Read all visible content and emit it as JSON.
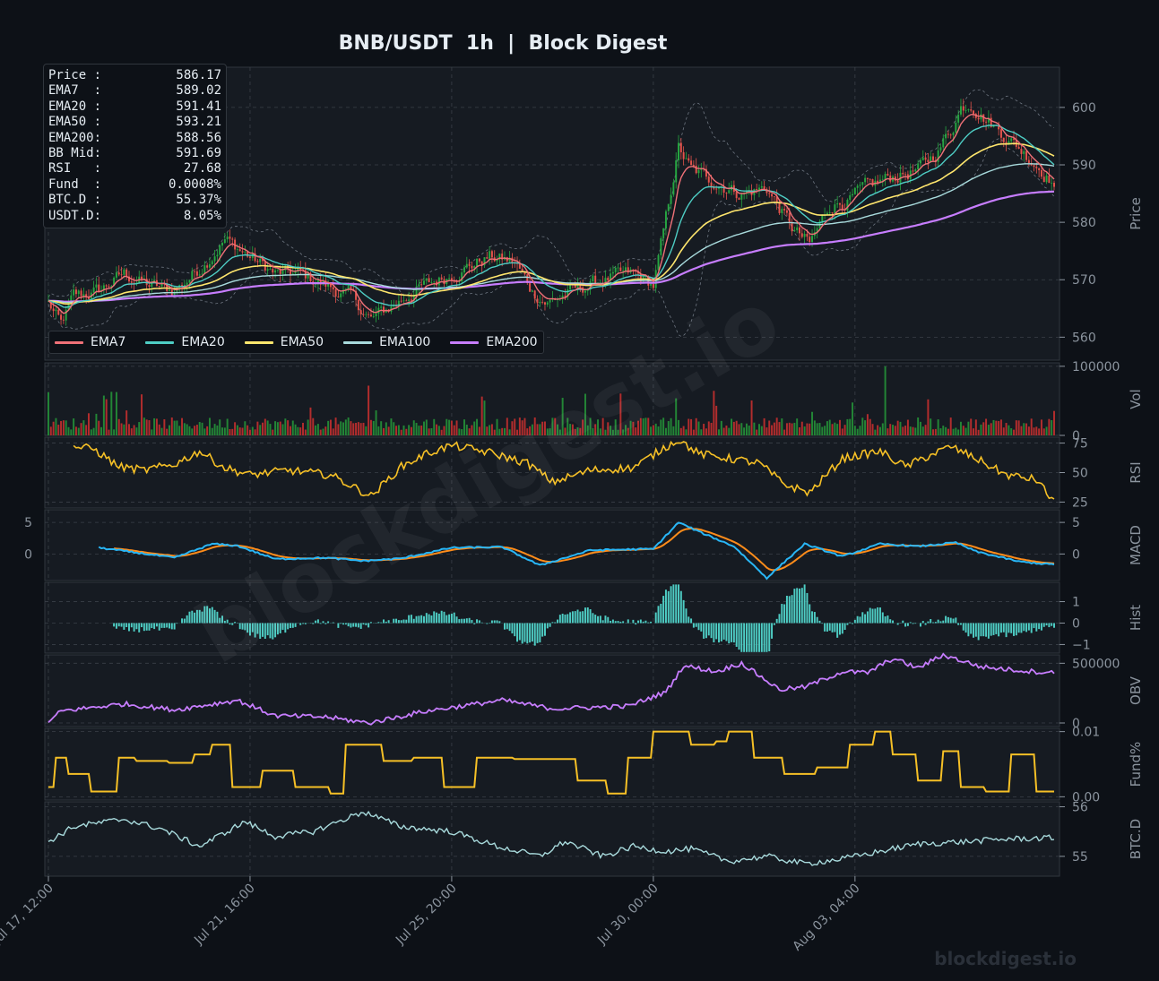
{
  "title": "BNB/USDT  1h  |  Block Digest",
  "info_box": [
    {
      "label": "Price :",
      "value": "586.17"
    },
    {
      "label": "EMA7  :",
      "value": "589.02"
    },
    {
      "label": "EMA20 :",
      "value": "591.41"
    },
    {
      "label": "EMA50 :",
      "value": "593.21"
    },
    {
      "label": "EMA200:",
      "value": "588.56"
    },
    {
      "label": "BB Mid:",
      "value": "591.69"
    },
    {
      "label": "RSI   :",
      "value": "27.68"
    },
    {
      "label": "Fund  :",
      "value": "0.0008%"
    },
    {
      "label": "BTC.D :",
      "value": "55.37%"
    },
    {
      "label": "USDT.D:",
      "value": "8.05%"
    }
  ],
  "watermark": "blockdigest.io",
  "diagonal_watermark": "blockdigest.io",
  "colors": {
    "background": "#0d1117",
    "panel": "#161b22",
    "grid": "#3a4048",
    "up": "#26a641",
    "down": "#e5534b",
    "ema7": "#f07178",
    "ema20": "#4ecdc4",
    "ema50": "#ffe66d",
    "ema100": "#a8dadc",
    "ema200": "#c77dff",
    "rsi": "#f6c026",
    "macd": "#29b6f6",
    "signal": "#ff8c1a",
    "hist": "#4ecdc4",
    "obv": "#c77dff",
    "funding": "#f6c026",
    "btcd": "#a8dadc"
  },
  "chart_data": {
    "type": "line",
    "x_ticks": [
      "Jul 17, 12:00",
      "Jul 21, 16:00",
      "Jul 25, 20:00",
      "Jul 30, 00:00",
      "Aug 03, 04:00"
    ],
    "legend": [
      "EMA7",
      "EMA20",
      "EMA50",
      "EMA100",
      "EMA200"
    ],
    "legend_placement": "lower-left",
    "grid": true,
    "panels": [
      {
        "name": "price",
        "ylabel": "Price",
        "ylim": [
          556,
          607
        ],
        "ticks": [
          "560",
          "570",
          "580",
          "590",
          "600"
        ]
      },
      {
        "name": "volume",
        "ylabel": "Vol",
        "ylim": [
          0,
          105000
        ],
        "ticks": [
          "0",
          "100000"
        ]
      },
      {
        "name": "rsi",
        "ylabel": "RSI",
        "ylim": [
          20,
          80
        ],
        "ticks": [
          "25",
          "50",
          "75"
        ]
      },
      {
        "name": "macd",
        "ylabel": "MACD",
        "ylim": [
          -4.2,
          7
        ],
        "ticks": [
          "0",
          "5"
        ],
        "left_ticks": [
          "0",
          "5"
        ]
      },
      {
        "name": "hist",
        "ylabel": "Hist",
        "ylim": [
          -1.4,
          1.9
        ],
        "ticks": [
          "−1",
          "0",
          "1"
        ]
      },
      {
        "name": "obv",
        "ylabel": "OBV",
        "ylim": [
          -30000,
          570000
        ],
        "ticks": [
          "0",
          "500000"
        ]
      },
      {
        "name": "funding",
        "ylabel": "Fund%",
        "ylim": [
          -0.0005,
          0.0105
        ],
        "ticks": [
          "0.00",
          "0.01"
        ]
      },
      {
        "name": "btcd",
        "ylabel": "BTC.D",
        "ylim": [
          54.6,
          56.1
        ],
        "ticks": [
          "55",
          "56"
        ]
      }
    ],
    "price_anchors": [
      [
        0,
        566
      ],
      [
        5,
        562
      ],
      [
        10,
        567
      ],
      [
        20,
        568
      ],
      [
        30,
        571
      ],
      [
        40,
        569
      ],
      [
        50,
        568
      ],
      [
        60,
        572
      ],
      [
        70,
        577
      ],
      [
        80,
        574
      ],
      [
        90,
        571
      ],
      [
        100,
        571
      ],
      [
        110,
        569
      ],
      [
        120,
        567
      ],
      [
        128,
        563
      ],
      [
        135,
        565
      ],
      [
        145,
        568
      ],
      [
        160,
        571
      ],
      [
        175,
        574
      ],
      [
        185,
        573
      ],
      [
        192,
        568
      ],
      [
        198,
        566
      ],
      [
        208,
        568
      ],
      [
        220,
        570
      ],
      [
        232,
        571
      ],
      [
        240,
        569
      ],
      [
        244,
        578
      ],
      [
        250,
        593
      ],
      [
        255,
        589
      ],
      [
        265,
        587
      ],
      [
        275,
        585
      ],
      [
        285,
        586
      ],
      [
        295,
        579
      ],
      [
        302,
        576
      ],
      [
        310,
        583
      ],
      [
        318,
        584
      ],
      [
        325,
        586
      ],
      [
        335,
        588
      ],
      [
        345,
        589
      ],
      [
        352,
        592
      ],
      [
        358,
        596
      ],
      [
        362,
        600
      ],
      [
        366,
        601
      ],
      [
        372,
        598
      ],
      [
        380,
        595
      ],
      [
        390,
        591
      ],
      [
        399,
        587
      ]
    ],
    "ema_last": {
      "EMA7": 589.02,
      "EMA20": 591.41,
      "EMA50": 593.21,
      "EMA200": 588.56
    },
    "ema100_last": 592.0,
    "rsi_anchors": [
      [
        10,
        72
      ],
      [
        18,
        70
      ],
      [
        28,
        55
      ],
      [
        38,
        52
      ],
      [
        50,
        57
      ],
      [
        60,
        68
      ],
      [
        70,
        54
      ],
      [
        80,
        48
      ],
      [
        95,
        52
      ],
      [
        112,
        48
      ],
      [
        128,
        30
      ],
      [
        140,
        55
      ],
      [
        150,
        66
      ],
      [
        160,
        73
      ],
      [
        175,
        67
      ],
      [
        190,
        58
      ],
      [
        200,
        42
      ],
      [
        215,
        52
      ],
      [
        232,
        54
      ],
      [
        245,
        72
      ],
      [
        250,
        78
      ],
      [
        258,
        66
      ],
      [
        270,
        62
      ],
      [
        282,
        58
      ],
      [
        292,
        40
      ],
      [
        302,
        33
      ],
      [
        315,
        62
      ],
      [
        330,
        68
      ],
      [
        340,
        55
      ],
      [
        350,
        65
      ],
      [
        358,
        72
      ],
      [
        368,
        62
      ],
      [
        380,
        48
      ],
      [
        392,
        44
      ],
      [
        397,
        30
      ],
      [
        399,
        27.68
      ]
    ],
    "macd_anchors": [
      [
        20,
        1.0
      ],
      [
        35,
        0.2
      ],
      [
        50,
        -0.6
      ],
      [
        65,
        1.6
      ],
      [
        75,
        1.3
      ],
      [
        90,
        -0.8
      ],
      [
        110,
        -0.6
      ],
      [
        125,
        -1.1
      ],
      [
        140,
        -0.7
      ],
      [
        160,
        1.0
      ],
      [
        180,
        1.1
      ],
      [
        195,
        -1.8
      ],
      [
        215,
        0.6
      ],
      [
        240,
        0.8
      ],
      [
        250,
        5.0
      ],
      [
        260,
        3.2
      ],
      [
        272,
        1.2
      ],
      [
        285,
        -3.8
      ],
      [
        300,
        1.6
      ],
      [
        315,
        -0.4
      ],
      [
        330,
        1.6
      ],
      [
        345,
        1.2
      ],
      [
        360,
        1.8
      ],
      [
        368,
        0.4
      ],
      [
        385,
        -1.2
      ],
      [
        396,
        -1.6
      ]
    ],
    "obv_anchors": [
      [
        0,
        0
      ],
      [
        5,
        100000
      ],
      [
        30,
        160000
      ],
      [
        50,
        110000
      ],
      [
        75,
        190000
      ],
      [
        90,
        60000
      ],
      [
        110,
        50000
      ],
      [
        127,
        0
      ],
      [
        150,
        100000
      ],
      [
        180,
        190000
      ],
      [
        200,
        120000
      ],
      [
        230,
        140000
      ],
      [
        245,
        260000
      ],
      [
        252,
        480000
      ],
      [
        265,
        430000
      ],
      [
        275,
        500000
      ],
      [
        290,
        280000
      ],
      [
        300,
        300000
      ],
      [
        315,
        430000
      ],
      [
        325,
        420000
      ],
      [
        335,
        540000
      ],
      [
        345,
        460000
      ],
      [
        355,
        570000
      ],
      [
        370,
        470000
      ],
      [
        385,
        440000
      ],
      [
        399,
        420000
      ]
    ],
    "funding_steps": [
      [
        0,
        0.0015
      ],
      [
        3,
        0.006
      ],
      [
        8,
        0.0035
      ],
      [
        17,
        0.0008
      ],
      [
        28,
        0.006
      ],
      [
        35,
        0.0055
      ],
      [
        48,
        0.0052
      ],
      [
        58,
        0.0065
      ],
      [
        65,
        0.008
      ],
      [
        73,
        0.0015
      ],
      [
        85,
        0.004
      ],
      [
        98,
        0.0015
      ],
      [
        112,
        0.0005
      ],
      [
        118,
        0.008
      ],
      [
        133,
        0.0055
      ],
      [
        145,
        0.006
      ],
      [
        157,
        0.0015
      ],
      [
        170,
        0.006
      ],
      [
        185,
        0.0058
      ],
      [
        210,
        0.0025
      ],
      [
        222,
        0.0005
      ],
      [
        230,
        0.006
      ],
      [
        240,
        0.01
      ],
      [
        255,
        0.008
      ],
      [
        265,
        0.0085
      ],
      [
        270,
        0.01
      ],
      [
        280,
        0.006
      ],
      [
        292,
        0.0035
      ],
      [
        305,
        0.0045
      ],
      [
        318,
        0.008
      ],
      [
        328,
        0.01
      ],
      [
        335,
        0.0065
      ],
      [
        345,
        0.0025
      ],
      [
        355,
        0.007
      ],
      [
        362,
        0.0015
      ],
      [
        372,
        0.0008
      ],
      [
        382,
        0.0065
      ],
      [
        392,
        0.0008
      ],
      [
        399,
        0.0008
      ]
    ],
    "btcd_anchors": [
      [
        0,
        55.3
      ],
      [
        10,
        55.6
      ],
      [
        30,
        55.75
      ],
      [
        45,
        55.55
      ],
      [
        60,
        55.2
      ],
      [
        78,
        55.7
      ],
      [
        90,
        55.4
      ],
      [
        105,
        55.5
      ],
      [
        125,
        55.9
      ],
      [
        140,
        55.6
      ],
      [
        160,
        55.5
      ],
      [
        178,
        55.2
      ],
      [
        195,
        55.0
      ],
      [
        205,
        55.3
      ],
      [
        220,
        55.0
      ],
      [
        232,
        55.2
      ],
      [
        245,
        55.1
      ],
      [
        255,
        55.15
      ],
      [
        270,
        54.9
      ],
      [
        285,
        55.0
      ],
      [
        300,
        54.85
      ],
      [
        315,
        54.95
      ],
      [
        325,
        55.05
      ],
      [
        345,
        55.25
      ],
      [
        365,
        55.3
      ],
      [
        380,
        55.35
      ],
      [
        399,
        55.37
      ]
    ]
  }
}
